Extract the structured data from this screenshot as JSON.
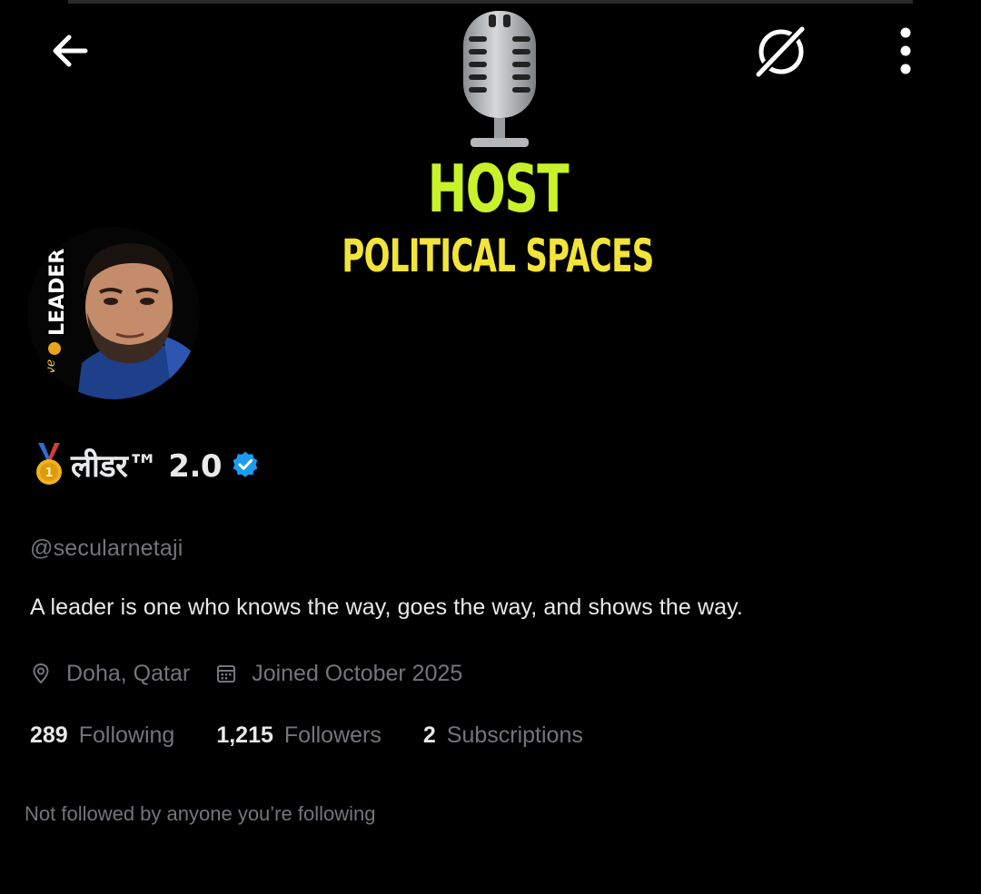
{
  "banner": {
    "headline": "HOST",
    "subheadline": "POLITICAL SPACES",
    "headline_color": "#c9f22a",
    "subheadline_color": "#f2e43a",
    "icon": "microphone-icon"
  },
  "topbar": {
    "back_icon": "back-arrow-icon",
    "grok_icon": "grok-icon",
    "more_icon": "more-vertical-icon"
  },
  "avatar": {
    "side_text": "LEADER",
    "script_text": "love"
  },
  "profile": {
    "display_name": "लीडर™ 2.0",
    "verified": true,
    "verified_color": "#1d9bf0",
    "handle": "@secularnetaji",
    "bio": "A leader is one who knows the way, goes the way, and shows the way.",
    "location": "Doha, Qatar",
    "joined": "Joined October 2025"
  },
  "stats": {
    "following_count": "289",
    "following_label": "Following",
    "followers_count": "1,215",
    "followers_label": "Followers",
    "subscriptions_count": "2",
    "subscriptions_label": "Subscriptions"
  },
  "footer": {
    "note": "Not followed by anyone you’re following"
  }
}
